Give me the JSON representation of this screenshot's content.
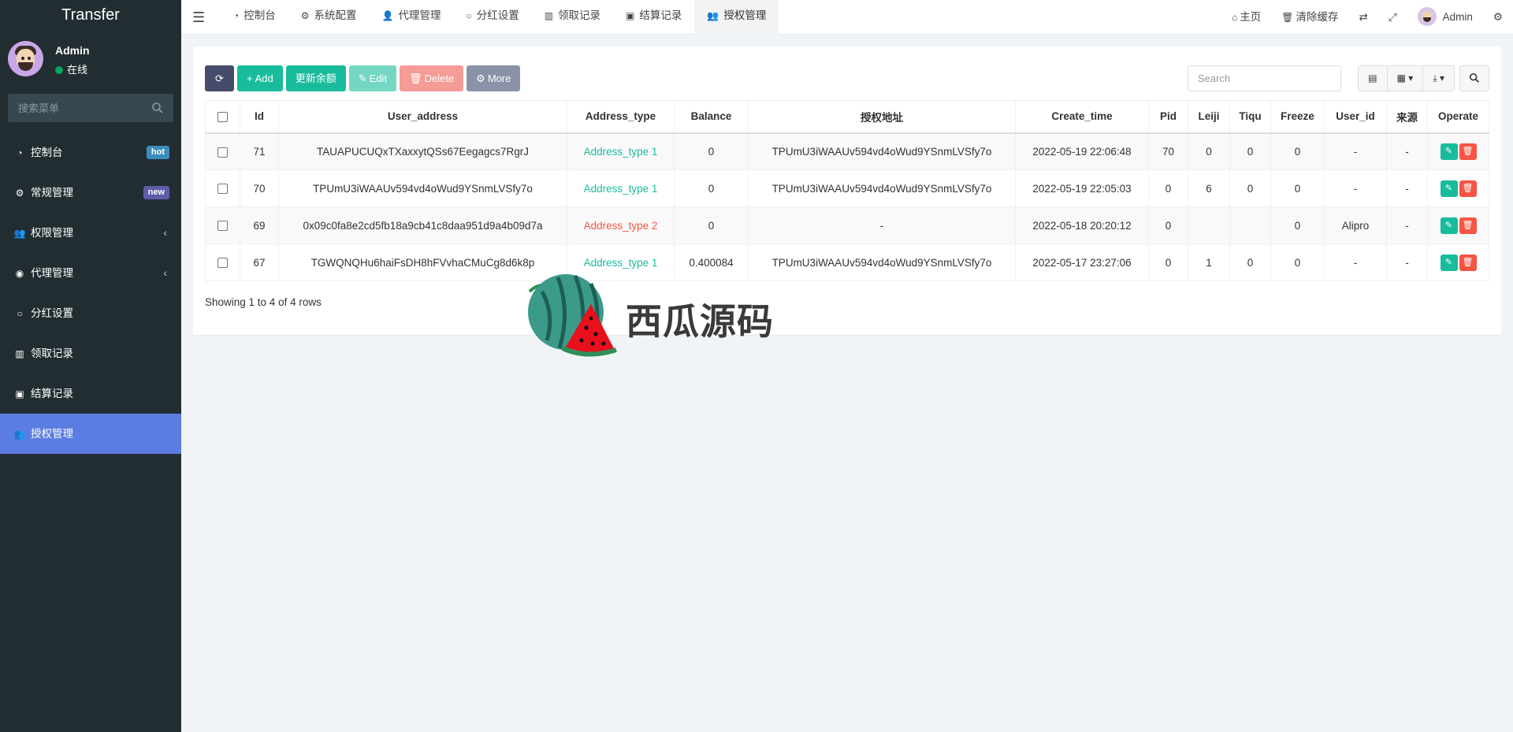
{
  "app": {
    "title": "Transfer"
  },
  "user": {
    "name": "Admin",
    "status": "在线"
  },
  "menu_search": {
    "placeholder": "搜索菜单"
  },
  "sidebar": {
    "items": [
      {
        "label": "控制台",
        "badge": "hot",
        "badge_color": "#3c8dbc",
        "icon": "dashboard-icon"
      },
      {
        "label": "常规管理",
        "badge": "new",
        "badge_color": "#605ca8",
        "icon": "cogs-icon"
      },
      {
        "label": "权限管理",
        "icon": "users-icon"
      },
      {
        "label": "代理管理",
        "icon": "user-circle-icon"
      },
      {
        "label": "分红设置",
        "icon": "circle-icon"
      },
      {
        "label": "领取记录",
        "icon": "bars-icon"
      },
      {
        "label": "结算记录",
        "icon": "list-alt-icon"
      },
      {
        "label": "授权管理",
        "icon": "users-icon",
        "active": true
      }
    ]
  },
  "tabs": [
    {
      "label": "控制台"
    },
    {
      "label": "系统配置"
    },
    {
      "label": "代理管理"
    },
    {
      "label": "分红设置"
    },
    {
      "label": "领取记录"
    },
    {
      "label": "结算记录"
    },
    {
      "label": "授权管理",
      "active": true
    }
  ],
  "topnav": {
    "home": "主页",
    "clear_cache": "清除缓存",
    "admin": "Admin"
  },
  "toolbar": {
    "add": "Add",
    "update_balance": "更新余额",
    "edit": "Edit",
    "delete": "Delete",
    "more": "More",
    "search_placeholder": "Search"
  },
  "table": {
    "columns": [
      "Id",
      "User_address",
      "Address_type",
      "Balance",
      "授权地址",
      "Create_time",
      "Pid",
      "Leiji",
      "Tiqu",
      "Freeze",
      "User_id",
      "来源",
      "Operate"
    ],
    "rows": [
      {
        "id": "71",
        "user_address": "TAUAPUCUQxTXaxxytQSs67Eegagcs7RgrJ",
        "address_type": "Address_type 1",
        "type_color": "green",
        "balance": "0",
        "auth_address": "TPUmU3iWAAUv594vd4oWud9YSnmLVSfy7o",
        "create_time": "2022-05-19 22:06:48",
        "pid": "70",
        "leiji": "0",
        "tiqu": "0",
        "freeze": "0",
        "user_id": "-",
        "source": "-"
      },
      {
        "id": "70",
        "user_address": "TPUmU3iWAAUv594vd4oWud9YSnmLVSfy7o",
        "address_type": "Address_type 1",
        "type_color": "green",
        "balance": "0",
        "auth_address": "TPUmU3iWAAUv594vd4oWud9YSnmLVSfy7o",
        "create_time": "2022-05-19 22:05:03",
        "pid": "0",
        "leiji": "6",
        "tiqu": "0",
        "freeze": "0",
        "user_id": "-",
        "source": "-"
      },
      {
        "id": "69",
        "user_address": "0x09c0fa8e2cd5fb18a9cb41c8daa951d9a4b09d7a",
        "address_type": "Address_type 2",
        "type_color": "red",
        "balance": "0",
        "auth_address": "-",
        "create_time": "2022-05-18 20:20:12",
        "pid": "0",
        "leiji": "",
        "tiqu": "",
        "freeze": "0",
        "user_id": "Alipro",
        "source": "-"
      },
      {
        "id": "67",
        "user_address": "TGWQNQHu6haiFsDH8hFVvhaCMuCg8d6k8p",
        "address_type": "Address_type 1",
        "type_color": "green",
        "balance": "0.400084",
        "auth_address": "TPUmU3iWAAUv594vd4oWud9YSnmLVSfy7o",
        "create_time": "2022-05-17 23:27:06",
        "pid": "0",
        "leiji": "1",
        "tiqu": "0",
        "freeze": "0",
        "user_id": "-",
        "source": "-"
      }
    ]
  },
  "pagination": {
    "info": "Showing 1 to 4 of 4 rows"
  },
  "watermark": {
    "text": "西瓜源码"
  }
}
